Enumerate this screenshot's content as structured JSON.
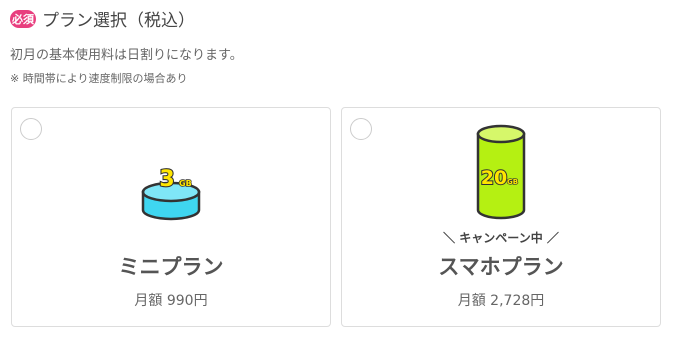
{
  "header": {
    "required_badge": "必須",
    "title": "プラン選択（税込）"
  },
  "description": "初月の基本使用料は日割りになります。",
  "note": "※ 時間帯により速度制限の場合あり",
  "plans": [
    {
      "name": "ミニプラン",
      "price": "月額 990円",
      "data_amount": "3",
      "unit": "GB",
      "icon": "cylinder-short-cyan",
      "color": "#3fd6f0"
    },
    {
      "name": "スマホプラン",
      "price": "月額 2,728円",
      "campaign": "＼ キャンペーン中 ／",
      "data_amount": "20",
      "unit": "GB",
      "icon": "cylinder-tall-lime",
      "color": "#b5f012"
    }
  ]
}
